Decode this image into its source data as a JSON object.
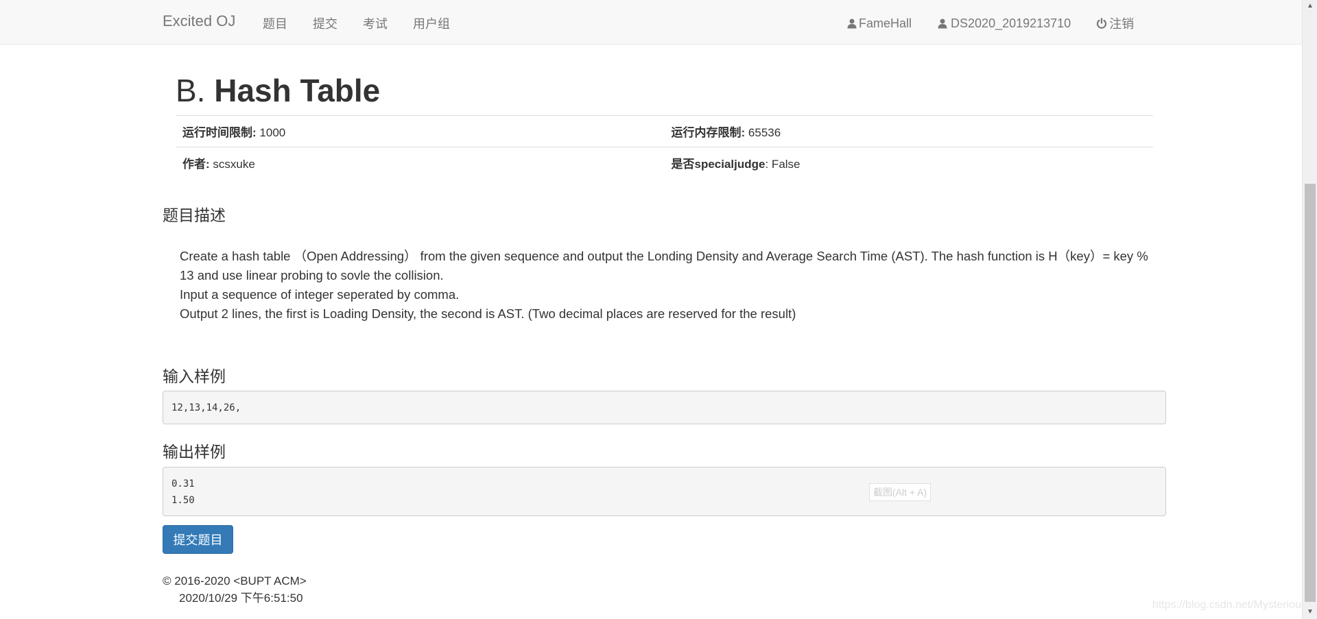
{
  "navbar": {
    "brand": "Excited OJ",
    "links": [
      "题目",
      "提交",
      "考试",
      "用户组"
    ],
    "right": {
      "fame": "FameHall",
      "user": "DS2020_2019213710",
      "logout": "注销"
    },
    "icons": {
      "fame": "user-icon",
      "user": "user-icon",
      "logout": "power-icon"
    }
  },
  "problem": {
    "index": "B.",
    "name": "Hash Table",
    "info": {
      "time_label": "运行时间限制:",
      "time_value": "1000",
      "memory_label": "运行内存限制:",
      "memory_value": "65536",
      "author_label": "作者:",
      "author_value": "scsxuke",
      "special_label": "是否specialjudge",
      "special_value": ": False"
    },
    "description_heading": "题目描述",
    "description": [
      "Create a hash table （Open Addressing） from the given sequence and output the Londing Density and Average Search Time (AST). The hash function is H（key）= key % 13 and use linear probing to sovle the collision.",
      "Input a sequence of integer seperated by comma.",
      "Output 2 lines, the first is Loading Density, the second is AST. (Two decimal places are reserved for the result)"
    ],
    "input_heading": "输入样例",
    "input_sample": "12,13,14,26,",
    "output_heading": "输出样例",
    "output_sample": "0.31\n1.50",
    "submit_label": "提交题目"
  },
  "tooltip": "截图(Alt + A)",
  "footer": {
    "copyright": "© 2016-2020 <BUPT ACM>",
    "time": "2020/10/29 下午6:51:50"
  },
  "watermark": "https://blog.csdn.net/Mysterious",
  "colors": {
    "primary": "#337ab7",
    "navbar_bg": "#f8f8f8",
    "nav_text": "#777777",
    "pre_bg": "#f5f5f5"
  }
}
